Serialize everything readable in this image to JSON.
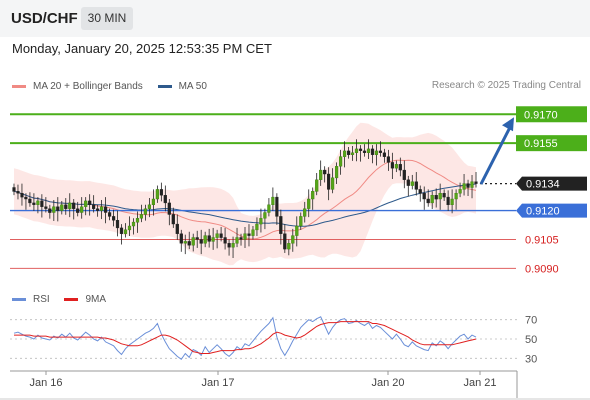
{
  "header": {
    "symbol": "USD/CHF",
    "timeframe": "30 MIN",
    "datetime": "Monday, January 20, 2025 12:53:35 PM CET"
  },
  "legend": {
    "ma_bb_label": "MA 20 + Bollinger Bands",
    "ma_bb_color": "#f08a84",
    "ma50_label": "MA 50",
    "ma50_color": "#2e5a8c",
    "research": "Research © 2025 Trading Central"
  },
  "rsi_legend": {
    "rsi_label": "RSI",
    "rsi_color": "#6a8fd8",
    "ma9_label": "9MA",
    "ma9_color": "#e02020"
  },
  "chart_data": {
    "type": "candlestick",
    "x_ticks": [
      "Jan 16",
      "Jan 17",
      "Jan 20",
      "Jan 21"
    ],
    "price_levels": [
      {
        "label": "0.9170",
        "role": "target",
        "color": "#4caf1a"
      },
      {
        "label": "0.9155",
        "role": "target",
        "color": "#4caf1a"
      },
      {
        "label": "0.9134",
        "role": "current",
        "color": "#222222"
      },
      {
        "label": "0.9120",
        "role": "pivot",
        "color": "#3a6fd8"
      },
      {
        "label": "0.9105",
        "role": "support",
        "color": "#e06060"
      },
      {
        "label": "0.9090",
        "role": "support",
        "color": "#e06060"
      }
    ],
    "y_range": [
      0.9085,
      0.918
    ],
    "close": [
      0.913,
      0.9129,
      0.9127,
      0.9126,
      0.9124,
      0.9123,
      0.9125,
      0.9122,
      0.9121,
      0.9119,
      0.9122,
      0.912,
      0.9123,
      0.9121,
      0.9124,
      0.9121,
      0.9119,
      0.9122,
      0.9125,
      0.9123,
      0.9121,
      0.912,
      0.9122,
      0.9119,
      0.9117,
      0.9115,
      0.9111,
      0.9108,
      0.911,
      0.9112,
      0.9114,
      0.9116,
      0.9118,
      0.9121,
      0.9123,
      0.9126,
      0.9131,
      0.9128,
      0.9124,
      0.9118,
      0.9113,
      0.9108,
      0.9103,
      0.9104,
      0.9102,
      0.9106,
      0.9105,
      0.9103,
      0.9107,
      0.9104,
      0.9106,
      0.9108,
      0.9106,
      0.9103,
      0.9101,
      0.9103,
      0.9106,
      0.9105,
      0.9108,
      0.9107,
      0.911,
      0.9113,
      0.9116,
      0.9119,
      0.9123,
      0.9127,
      0.9117,
      0.9108,
      0.91,
      0.9103,
      0.9107,
      0.9112,
      0.9117,
      0.9121,
      0.9126,
      0.913,
      0.9136,
      0.9141,
      0.9139,
      0.9131,
      0.9137,
      0.9143,
      0.9148,
      0.9151,
      0.9149,
      0.915,
      0.9152,
      0.9151,
      0.915,
      0.9152,
      0.9149,
      0.9151,
      0.915,
      0.9148,
      0.9145,
      0.9142,
      0.9144,
      0.9141,
      0.9136,
      0.9133,
      0.9135,
      0.9131,
      0.9129,
      0.9126,
      0.9124,
      0.9128,
      0.9126,
      0.9129,
      0.9127,
      0.9123,
      0.9126,
      0.9129,
      0.9131,
      0.9134,
      0.9132,
      0.9135,
      0.9134
    ],
    "projection": {
      "from": 0.9134,
      "to": 0.917
    },
    "rsi_ticks": [
      "70",
      "50",
      "30"
    ],
    "rsi_range": [
      20,
      80
    ],
    "rsi": [
      56,
      57,
      55,
      53,
      52,
      50,
      54,
      51,
      50,
      49,
      53,
      51,
      55,
      52,
      56,
      51,
      49,
      53,
      57,
      54,
      50,
      48,
      52,
      47,
      45,
      43,
      38,
      34,
      40,
      44,
      47,
      50,
      53,
      56,
      58,
      61,
      66,
      55,
      47,
      40,
      36,
      32,
      29,
      35,
      31,
      39,
      37,
      33,
      42,
      36,
      40,
      44,
      40,
      35,
      32,
      36,
      42,
      39,
      45,
      43,
      48,
      53,
      58,
      62,
      66,
      72,
      52,
      40,
      33,
      40,
      48,
      55,
      62,
      66,
      70,
      68,
      71,
      73,
      64,
      55,
      62,
      67,
      70,
      71,
      66,
      67,
      69,
      66,
      64,
      67,
      61,
      64,
      62,
      58,
      54,
      50,
      55,
      50,
      44,
      42,
      47,
      43,
      41,
      39,
      38,
      46,
      43,
      48,
      45,
      40,
      45,
      49,
      53,
      55,
      50,
      54,
      52
    ],
    "rsi_ma": [
      54,
      54,
      54,
      54,
      54,
      53,
      53,
      53,
      53,
      52,
      52,
      52,
      52,
      52,
      52,
      52,
      52,
      52,
      52,
      52,
      52,
      52,
      51,
      51,
      50,
      49,
      47,
      45,
      44,
      43,
      43,
      43,
      44,
      46,
      48,
      50,
      52,
      54,
      54,
      53,
      51,
      49,
      46,
      43,
      40,
      37,
      36,
      35,
      35,
      35,
      36,
      37,
      38,
      38,
      38,
      38,
      39,
      39,
      40,
      40,
      41,
      43,
      45,
      48,
      51,
      55,
      57,
      56,
      54,
      53,
      52,
      51,
      52,
      54,
      57,
      60,
      63,
      65,
      66,
      67,
      67,
      67,
      68,
      68,
      68,
      68,
      68,
      68,
      68,
      68,
      66,
      66,
      65,
      64,
      62,
      60,
      58,
      56,
      54,
      52,
      49,
      47,
      45,
      44,
      44,
      44,
      44,
      44,
      44,
      44,
      44,
      45,
      46,
      47,
      48,
      49,
      50
    ]
  }
}
